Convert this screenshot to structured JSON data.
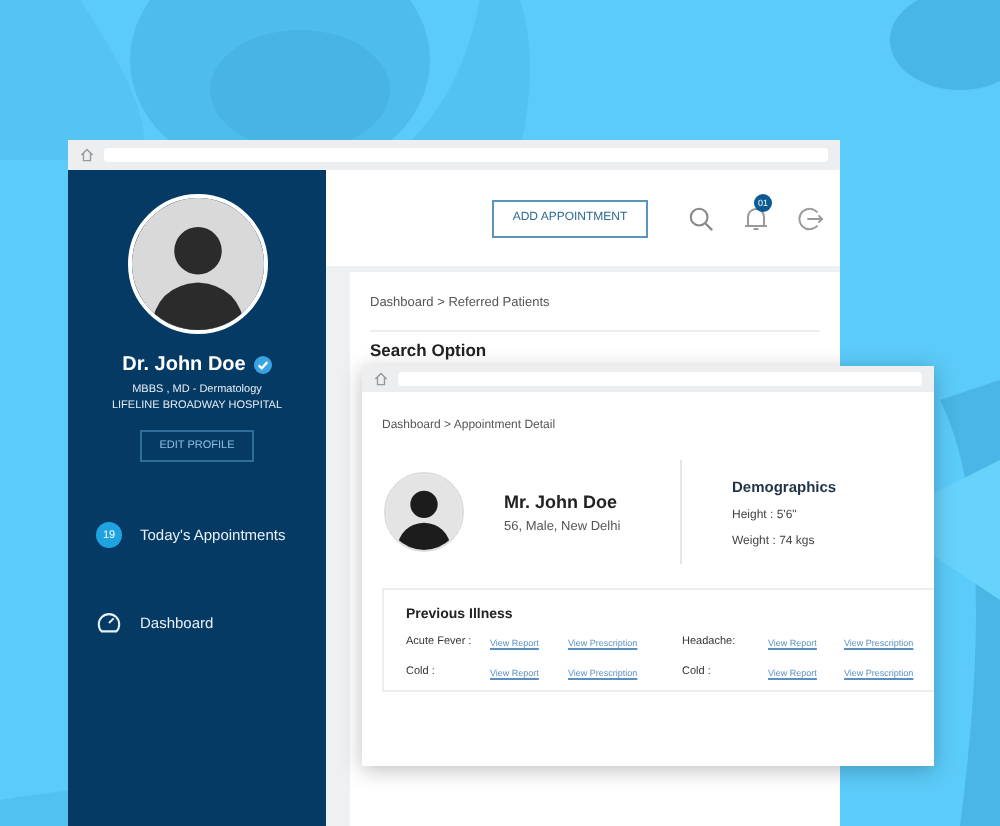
{
  "sidebar": {
    "doctor_name": "Dr. John Doe",
    "verified": true,
    "qualification": "MBBS , MD - Dermatology",
    "hospital": "LIFELINE BROADWAY HOSPITAL",
    "edit_button": "EDIT PROFILE",
    "items": [
      {
        "kind": "count",
        "badge": "19",
        "label": "Today's Appointments"
      },
      {
        "kind": "gauge",
        "label": "Dashboard"
      }
    ]
  },
  "header": {
    "add_button": "ADD APPOINTMENT",
    "notification_count": "01"
  },
  "back_window": {
    "breadcrumb": "Dashboard > Referred Patients",
    "section_title": "Search Option"
  },
  "detail_window": {
    "breadcrumb": "Dashboard > Appointment Detail",
    "patient": {
      "name": "Mr. John Doe",
      "details": "56, Male, New Delhi"
    },
    "demographics": {
      "title": "Demographics",
      "lines": [
        "Height : 5'6\"",
        "Weight : 74 kgs"
      ]
    },
    "previous_illness": {
      "title": "Previous Illness",
      "entries": [
        {
          "condition": "Acute Fever :",
          "links": [
            "View Report",
            "View Prescription"
          ]
        },
        {
          "condition": "Headache:",
          "links": [
            "View Report",
            "View Prescription"
          ]
        },
        {
          "condition": "Cold :",
          "links": [
            "View Report",
            "View Prescription"
          ]
        },
        {
          "condition": "Cold :",
          "links": [
            "View Report",
            "View Prescription"
          ]
        }
      ]
    }
  }
}
